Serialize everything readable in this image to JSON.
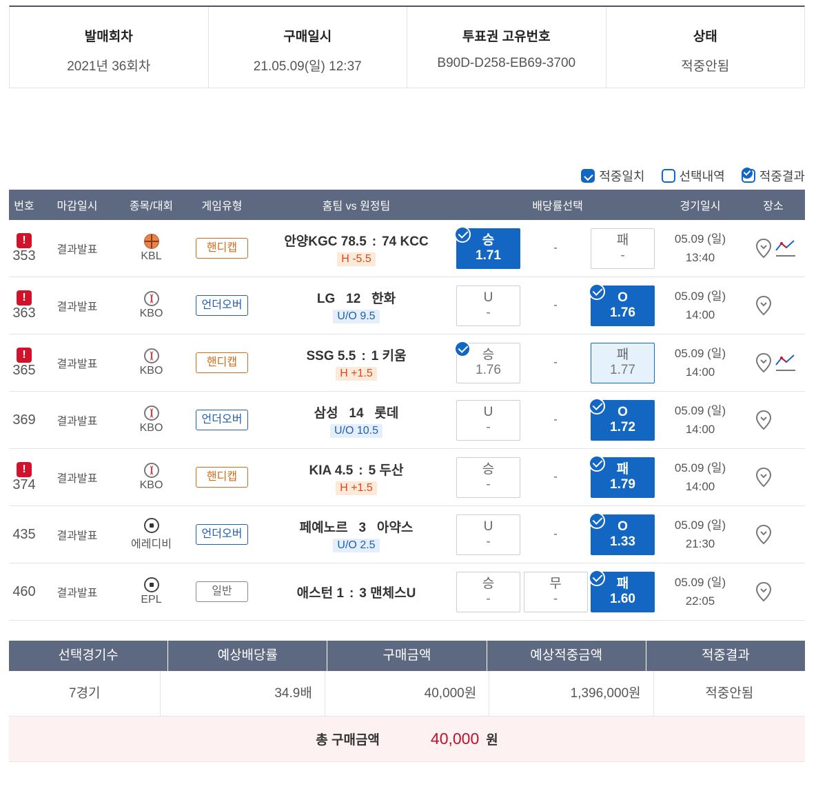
{
  "info": {
    "round_label": "발매회차",
    "round_value": "2021년 36회차",
    "purchase_label": "구매일시",
    "purchase_value": "21.05.09(일) 12:37",
    "ticket_label": "투표권 고유번호",
    "ticket_value": "B90D-D258-EB69-3700",
    "status_label": "상태",
    "status_value": "적중안됨"
  },
  "legend": {
    "hit": "적중일치",
    "selected": "선택내역",
    "result": "적중결과"
  },
  "headers": {
    "no": "번호",
    "deadline": "마감일시",
    "sport": "종목/대회",
    "type": "게임유형",
    "match": "홈팀 vs 원정팀",
    "odds": "배당률선택",
    "date": "경기일시",
    "place": "장소"
  },
  "rows": [
    {
      "no": "353",
      "warn": "!",
      "deadline": "결과발표",
      "sport_icon": "basketball-icon",
      "league": "KBL",
      "type": "핸디캡",
      "home": "안양KGC",
      "home_score": "78.5",
      "sep": ":",
      "away_score": "74",
      "away": "KCC",
      "sub": "H -5.5",
      "opt1_label": "승",
      "opt1_val": "1.71",
      "opt2": "-",
      "opt3_label": "패",
      "opt3_val": "-",
      "date": "05.09 (일)",
      "time": "13:40"
    },
    {
      "no": "363",
      "warn": "!",
      "deadline": "결과발표",
      "sport_icon": "baseball-icon",
      "league": "KBO",
      "type": "언더오버",
      "home": "LG",
      "home_score": "12",
      "sep": "",
      "away_score": "",
      "away": "한화",
      "sub": "U/O 9.5",
      "opt1_label": "U",
      "opt1_val": "-",
      "opt2": "-",
      "opt3_label": "O",
      "opt3_val": "1.76",
      "date": "05.09 (일)",
      "time": "14:00"
    },
    {
      "no": "365",
      "warn": "!",
      "deadline": "결과발표",
      "sport_icon": "baseball-icon",
      "league": "KBO",
      "type": "핸디캡",
      "home": "SSG",
      "home_score": "5.5",
      "sep": ":",
      "away_score": "1",
      "away": "키움",
      "sub": "H +1.5",
      "opt1_label": "승",
      "opt1_val": "1.76",
      "opt2": "-",
      "opt3_label": "패",
      "opt3_val": "1.77",
      "date": "05.09 (일)",
      "time": "14:00"
    },
    {
      "no": "369",
      "warn": "",
      "deadline": "결과발표",
      "sport_icon": "baseball-icon",
      "league": "KBO",
      "type": "언더오버",
      "home": "삼성",
      "home_score": "14",
      "sep": "",
      "away_score": "",
      "away": "롯데",
      "sub": "U/O 10.5",
      "opt1_label": "U",
      "opt1_val": "-",
      "opt2": "-",
      "opt3_label": "O",
      "opt3_val": "1.72",
      "date": "05.09 (일)",
      "time": "14:00"
    },
    {
      "no": "374",
      "warn": "!",
      "deadline": "결과발표",
      "sport_icon": "baseball-icon",
      "league": "KBO",
      "type": "핸디캡",
      "home": "KIA",
      "home_score": "4.5",
      "sep": ":",
      "away_score": "5",
      "away": "두산",
      "sub": "H +1.5",
      "opt1_label": "승",
      "opt1_val": "-",
      "opt2": "-",
      "opt3_label": "패",
      "opt3_val": "1.79",
      "date": "05.09 (일)",
      "time": "14:00"
    },
    {
      "no": "435",
      "warn": "",
      "deadline": "결과발표",
      "sport_icon": "soccer-icon",
      "league": "에레디비",
      "type": "언더오버",
      "home": "페예노르",
      "home_score": "3",
      "sep": "",
      "away_score": "",
      "away": "아약스",
      "sub": "U/O 2.5",
      "opt1_label": "U",
      "opt1_val": "-",
      "opt2": "-",
      "opt3_label": "O",
      "opt3_val": "1.33",
      "date": "05.09 (일)",
      "time": "21:30"
    },
    {
      "no": "460",
      "warn": "",
      "deadline": "결과발표",
      "sport_icon": "soccer-icon",
      "league": "EPL",
      "type": "일반",
      "home": "애스턴",
      "home_score": "1",
      "sep": ":",
      "away_score": "3",
      "away": "맨체스U",
      "sub": "",
      "opt1_label": "승",
      "opt1_val": "-",
      "opt2_label": "무",
      "opt2_val": "-",
      "opt3_label": "패",
      "opt3_val": "1.60",
      "date": "05.09 (일)",
      "time": "22:05"
    }
  ],
  "summary": {
    "h1": "선택경기수",
    "h2": "예상배당률",
    "h3": "구매금액",
    "h4": "예상적중금액",
    "h5": "적중결과",
    "v1": "7경기",
    "v2": "34.9배",
    "v3": "40,000원",
    "v4": "1,396,000원",
    "v5": "적중안됨",
    "total_label": "총 구매금액",
    "total_amount": "40,000",
    "total_unit": "원"
  },
  "colors": {
    "header_bg": "#5d6881",
    "accent_blue": "#1366c2",
    "warn_red": "#d0132a",
    "total_red": "#c0102b"
  }
}
